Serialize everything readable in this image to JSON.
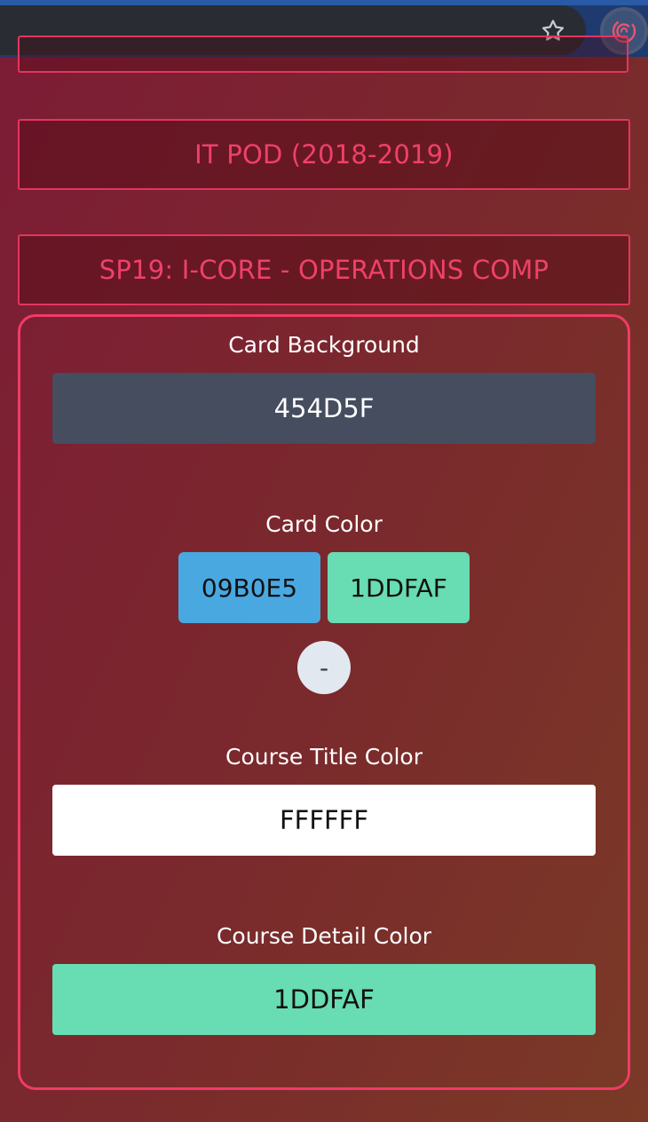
{
  "browser": {
    "star_icon": "star-icon",
    "extension_icon": "extension-swirl-icon",
    "colors": {
      "toolbar": "#1e3a6e",
      "omnibox": "#292d33",
      "extension_accent": "#e5566f"
    }
  },
  "courses": {
    "partial_label": "",
    "items": [
      {
        "label": "IT POD (2018-2019)"
      },
      {
        "label": "SP19: I-CORE - OPERATIONS COMP"
      }
    ],
    "accent_color": "#e2365e"
  },
  "settings": {
    "card_background": {
      "label": "Card Background",
      "value": "454D5F",
      "swatch": "#454D5F"
    },
    "card_color": {
      "label": "Card Color",
      "chips": [
        {
          "value": "09B0E5",
          "swatch": "#4aa8e0"
        },
        {
          "value": "1DDFAF",
          "swatch": "#68dcb2"
        }
      ],
      "remove_label": "-"
    },
    "course_title_color": {
      "label": "Course Title Color",
      "value": "FFFFFF",
      "swatch": "#FFFFFF"
    },
    "course_detail_color": {
      "label": "Course Detail Color",
      "value": "1DDFAF",
      "swatch": "#68dcb2"
    }
  }
}
